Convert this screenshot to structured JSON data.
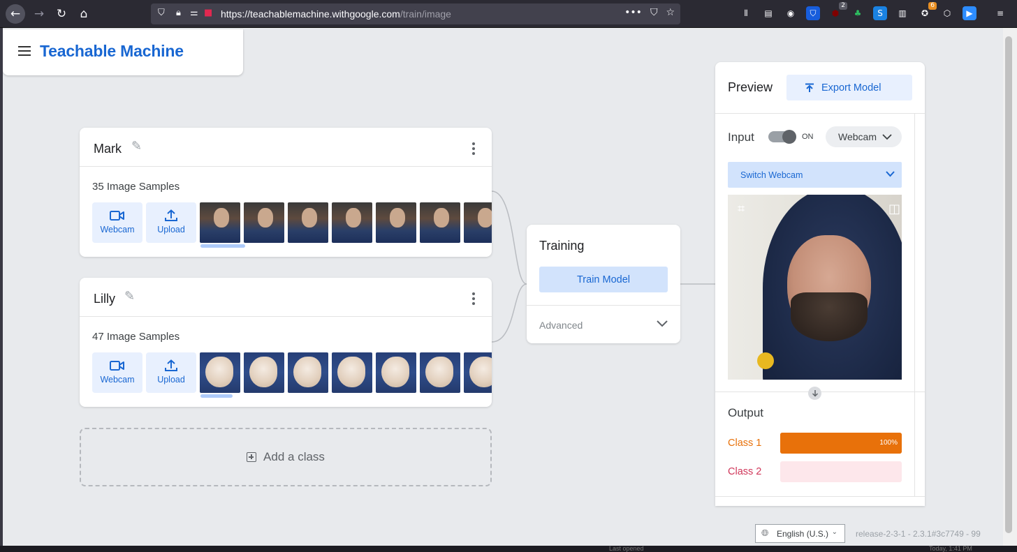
{
  "browser": {
    "url_host": "https://teachablemachine.withgoogle.com",
    "url_path": "/train/image",
    "badges": {
      "ublock": "2",
      "ext": "6"
    }
  },
  "app": {
    "title": "Teachable Machine"
  },
  "classes": [
    {
      "name": "Mark",
      "samples_label": "35 Image Samples",
      "webcam_label": "Webcam",
      "upload_label": "Upload",
      "thumb_count": 7
    },
    {
      "name": "Lilly",
      "samples_label": "47 Image Samples",
      "webcam_label": "Webcam",
      "upload_label": "Upload",
      "thumb_count": 7
    }
  ],
  "add_class": {
    "label": "Add a class"
  },
  "training": {
    "title": "Training",
    "button": "Train Model",
    "advanced": "Advanced"
  },
  "preview": {
    "title": "Preview",
    "export_button": "Export Model",
    "input_label": "Input",
    "toggle_state": "ON",
    "camera_select": "Webcam",
    "switch_webcam": "Switch Webcam",
    "output_label": "Output",
    "outputs": [
      {
        "label": "Class 1",
        "percent_label": "100%",
        "confidence": 1.0,
        "color": "#e8710a",
        "track_color": "#e8710a",
        "label_color": "#e8710a"
      },
      {
        "label": "Class 2",
        "percent_label": "",
        "confidence": 0.0,
        "color": "#d0375a",
        "track_color": "#fde7eb",
        "label_color": "#d0375a"
      }
    ]
  },
  "footer": {
    "language": "English (U.S.)",
    "release": "release-2-3-1 - 2.3.1#3c7749 - 99"
  },
  "taskbar": {
    "left_text": "Last opened",
    "right_text": "Today, 1:41 PM"
  },
  "colors": {
    "accent": "#1967d2",
    "accent_light": "#d2e3fc",
    "background": "#e8eaed"
  }
}
